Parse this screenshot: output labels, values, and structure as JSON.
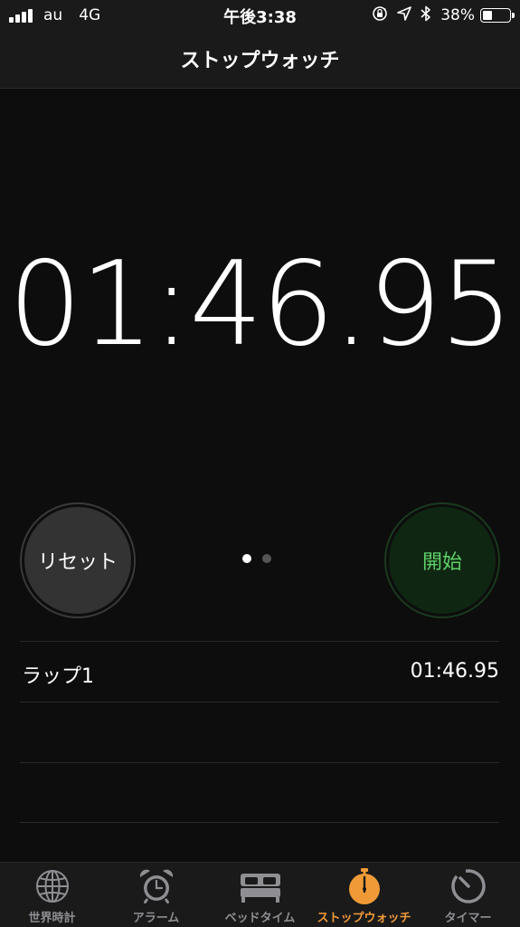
{
  "status_bar": {
    "carrier": "au",
    "network": "4G",
    "time": "午後3:38",
    "battery_text": "38%",
    "battery_level": 0.38,
    "icons": [
      "signal-icon",
      "rotation-lock-icon",
      "location-arrow-icon",
      "bluetooth-icon",
      "battery-icon"
    ]
  },
  "nav": {
    "title": "ストップウォッチ"
  },
  "timer": {
    "display": "01:46.95"
  },
  "controls": {
    "reset_label": "リセット",
    "start_label": "開始",
    "page_dots": {
      "count": 2,
      "active_index": 0
    }
  },
  "laps": [
    {
      "label": "ラップ1",
      "time": "01:46.95"
    }
  ],
  "tabs": [
    {
      "label": "世界時計",
      "icon": "globe-icon",
      "active": false
    },
    {
      "label": "アラーム",
      "icon": "alarm-clock-icon",
      "active": false
    },
    {
      "label": "ベッドタイム",
      "icon": "bed-icon",
      "active": false
    },
    {
      "label": "ストップウォッチ",
      "icon": "stopwatch-icon",
      "active": true
    },
    {
      "label": "タイマー",
      "icon": "timer-icon",
      "active": false
    }
  ],
  "colors": {
    "background": "#0d0d0d",
    "bar_background": "#1a1a1a",
    "accent_orange": "#f09a37",
    "start_green_text": "#5fd068",
    "start_green_bg": "#0f2712",
    "reset_bg": "#333333",
    "inactive_gray": "#8e8e93"
  }
}
